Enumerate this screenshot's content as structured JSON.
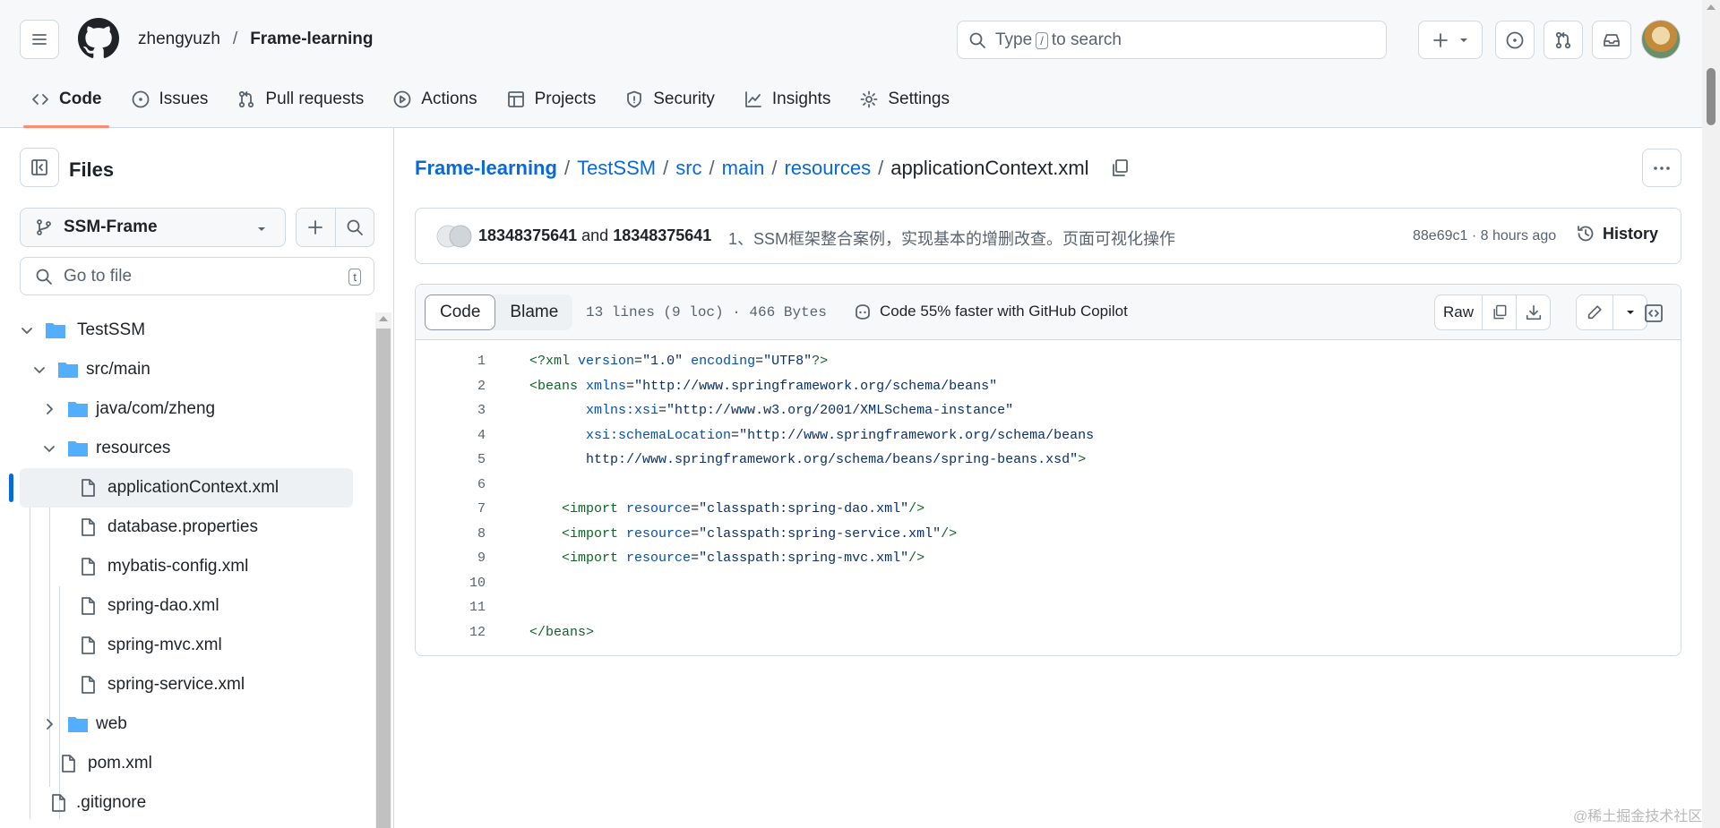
{
  "header": {
    "owner": "zhengyuzh",
    "separator": "/",
    "repo": "Frame-learning",
    "search_placeholder_pre": "Type",
    "search_key": "/",
    "search_placeholder_post": "to search"
  },
  "tabs": [
    {
      "label": "Code",
      "icon": "code-icon"
    },
    {
      "label": "Issues",
      "icon": "issue-icon"
    },
    {
      "label": "Pull requests",
      "icon": "pull-request-icon"
    },
    {
      "label": "Actions",
      "icon": "play-icon"
    },
    {
      "label": "Projects",
      "icon": "table-icon"
    },
    {
      "label": "Security",
      "icon": "shield-icon"
    },
    {
      "label": "Insights",
      "icon": "graph-icon"
    },
    {
      "label": "Settings",
      "icon": "gear-icon"
    }
  ],
  "sidebar": {
    "title": "Files",
    "branch": "SSM-Frame",
    "go_to_file": "Go to file",
    "go_to_file_key": "t",
    "tree": [
      {
        "label": "TestSSM",
        "type": "folder",
        "expanded": true
      },
      {
        "label": "src/main",
        "type": "folder",
        "expanded": true
      },
      {
        "label": "java/com/zheng",
        "type": "folder",
        "expanded": false
      },
      {
        "label": "resources",
        "type": "folder",
        "expanded": true
      },
      {
        "label": "applicationContext.xml",
        "type": "file",
        "selected": true
      },
      {
        "label": "database.properties",
        "type": "file"
      },
      {
        "label": "mybatis-config.xml",
        "type": "file"
      },
      {
        "label": "spring-dao.xml",
        "type": "file"
      },
      {
        "label": "spring-mvc.xml",
        "type": "file"
      },
      {
        "label": "spring-service.xml",
        "type": "file"
      },
      {
        "label": "web",
        "type": "folder",
        "expanded": false
      },
      {
        "label": "pom.xml",
        "type": "file"
      },
      {
        "label": ".gitignore",
        "type": "file"
      }
    ]
  },
  "breadcrumb": {
    "parts": [
      "Frame-learning",
      "TestSSM",
      "src",
      "main",
      "resources"
    ],
    "sep": "/",
    "current": "applicationContext.xml"
  },
  "commit": {
    "author1": "18348375641",
    "and": "and",
    "author2": "18348375641",
    "message": "1、SSM框架整合案例，实现基本的增删改查。页面可视化操作",
    "meta": "88e69c1 · 8 hours ago",
    "history": "History"
  },
  "file": {
    "tab_code": "Code",
    "tab_blame": "Blame",
    "meta": "13 lines (9 loc) · 466 Bytes",
    "copilot": "Code 55% faster with GitHub Copilot",
    "raw": "Raw",
    "lines": [
      "1",
      "2",
      "3",
      "4",
      "5",
      "6",
      "7",
      "8",
      "9",
      "10",
      "11",
      "12"
    ]
  },
  "watermark": "@稀土掘金技术社区",
  "colors": {
    "link": "#0969da",
    "active_tab_underline": "#fd8c73",
    "folder": "#54aeff",
    "border": "#d1d9e0"
  }
}
